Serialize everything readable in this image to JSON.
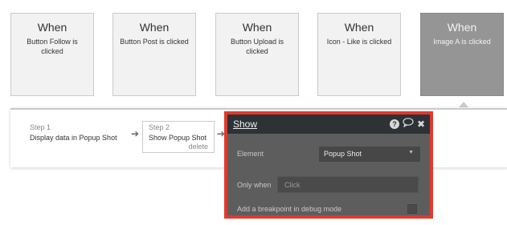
{
  "events": [
    {
      "when": "When",
      "desc": "Button Follow is clicked"
    },
    {
      "when": "When",
      "desc": "Button Post is clicked"
    },
    {
      "when": "When",
      "desc": "Button Upload is clicked"
    },
    {
      "when": "When",
      "desc": "Icon - Like is clicked"
    },
    {
      "when": "When",
      "desc": "Image A is clicked"
    }
  ],
  "steps": [
    {
      "num": "Step 1",
      "label": "Display data in Popup Shot"
    },
    {
      "num": "Step 2",
      "label": "Show Popup Shot",
      "delete_label": "delete"
    }
  ],
  "arrows": [
    "➔",
    "➔"
  ],
  "popup": {
    "title": "Show",
    "help_icon": "?",
    "comment_icon": "💬",
    "close_icon": "✖",
    "element_label": "Element",
    "element_value": "Popup Shot",
    "select_arrow": "▼",
    "only_when_label": "Only when",
    "only_when_placeholder": "Click",
    "debug_label": "Add a breakpoint in debug mode"
  },
  "colors": {
    "highlight_border": "#e03a2e",
    "popup_bg": "#5d5d5d",
    "popup_header": "#2d3236",
    "selected_card": "#959595"
  }
}
